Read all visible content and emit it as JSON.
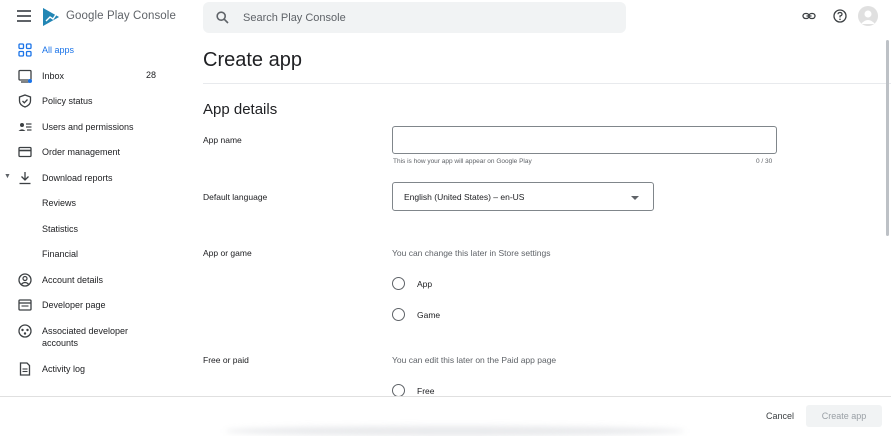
{
  "header": {
    "brand": "Google Play Console",
    "search_placeholder": "Search Play Console"
  },
  "sidebar": {
    "items": [
      {
        "label": "All apps",
        "icon": "apps-grid-icon",
        "active": true
      },
      {
        "label": "Inbox",
        "icon": "inbox-icon",
        "count": "28"
      },
      {
        "label": "Policy status",
        "icon": "shield-icon"
      },
      {
        "label": "Users and permissions",
        "icon": "users-icon"
      },
      {
        "label": "Order management",
        "icon": "credit-card-icon"
      },
      {
        "label": "Download reports",
        "icon": "download-icon",
        "expanded": true
      },
      {
        "label": "Reviews"
      },
      {
        "label": "Statistics"
      },
      {
        "label": "Financial"
      },
      {
        "label": "Account details",
        "icon": "account-circle-icon"
      },
      {
        "label": "Developer page",
        "icon": "web-page-icon"
      },
      {
        "label": "Associated developer accounts",
        "icon": "linked-accounts-icon"
      },
      {
        "label": "Activity log",
        "icon": "document-icon"
      }
    ]
  },
  "main": {
    "title": "Create app",
    "section_title": "App details",
    "app_name": {
      "label": "App name",
      "value": "",
      "helper": "This is how your app will appear on Google Play",
      "counter": "0 / 30"
    },
    "default_language": {
      "label": "Default language",
      "value": "English (United States) – en-US"
    },
    "app_or_game": {
      "label": "App or game",
      "hint": "You can change this later in Store settings",
      "options": [
        "App",
        "Game"
      ]
    },
    "free_or_paid": {
      "label": "Free or paid",
      "hint": "You can edit this later on the Paid app page",
      "options": [
        "Free"
      ]
    }
  },
  "footer": {
    "cancel_label": "Cancel",
    "create_label": "Create app"
  },
  "colors": {
    "accent": "#1a73e8",
    "text": "#202124",
    "muted": "#5f6368"
  }
}
